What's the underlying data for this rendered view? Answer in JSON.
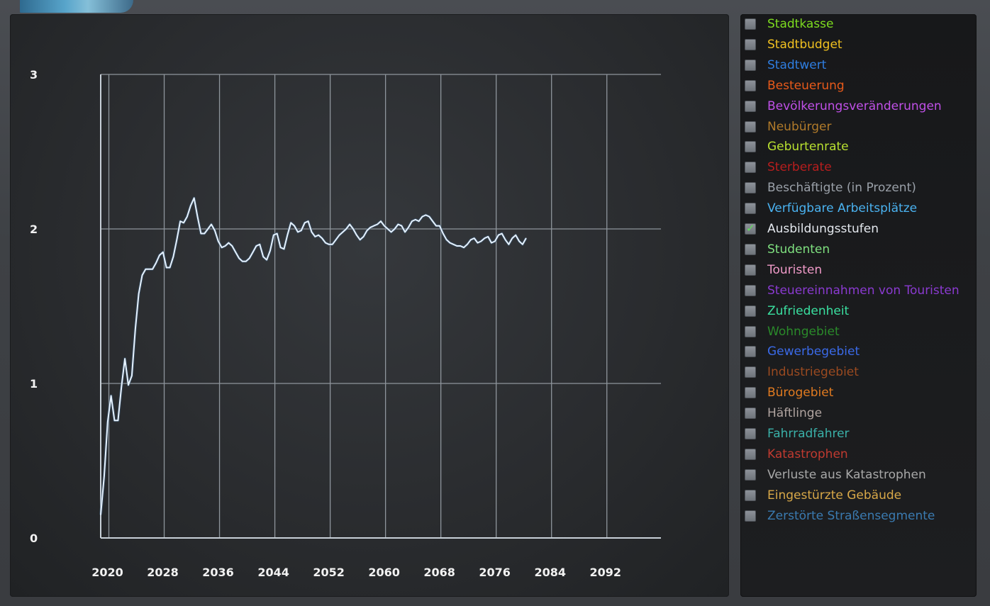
{
  "chart_data": {
    "type": "line",
    "y_ticks": [
      "0",
      "1",
      "2",
      "3"
    ],
    "ylim": [
      0,
      3
    ],
    "x_ticks": [
      "2020",
      "2028",
      "2036",
      "2044",
      "2052",
      "2060",
      "2068",
      "2076",
      "2084",
      "2092"
    ],
    "xlim": [
      2018,
      2099
    ],
    "grid": true,
    "series": [
      {
        "color": "#e6f2ff",
        "points": [
          [
            2018.0,
            0.15
          ],
          [
            2018.5,
            0.4
          ],
          [
            2019.0,
            0.75
          ],
          [
            2019.5,
            0.92
          ],
          [
            2020.0,
            0.76
          ],
          [
            2020.5,
            0.76
          ],
          [
            2021.0,
            0.98
          ],
          [
            2021.5,
            1.16
          ],
          [
            2022.0,
            0.99
          ],
          [
            2022.5,
            1.05
          ],
          [
            2023.0,
            1.35
          ],
          [
            2023.5,
            1.58
          ],
          [
            2024.0,
            1.7
          ],
          [
            2024.5,
            1.74
          ],
          [
            2025.0,
            1.74
          ],
          [
            2025.5,
            1.74
          ],
          [
            2026.0,
            1.78
          ],
          [
            2026.5,
            1.83
          ],
          [
            2027.0,
            1.85
          ],
          [
            2027.5,
            1.75
          ],
          [
            2028.0,
            1.75
          ],
          [
            2028.5,
            1.82
          ],
          [
            2029.0,
            1.93
          ],
          [
            2029.5,
            2.05
          ],
          [
            2030.0,
            2.04
          ],
          [
            2030.5,
            2.08
          ],
          [
            2031.0,
            2.15
          ],
          [
            2031.5,
            2.2
          ],
          [
            2032.0,
            2.08
          ],
          [
            2032.5,
            1.97
          ],
          [
            2033.0,
            1.97
          ],
          [
            2033.5,
            2.0
          ],
          [
            2034.0,
            2.03
          ],
          [
            2034.5,
            1.99
          ],
          [
            2035.0,
            1.92
          ],
          [
            2035.5,
            1.88
          ],
          [
            2036.0,
            1.89
          ],
          [
            2036.5,
            1.91
          ],
          [
            2037.0,
            1.89
          ],
          [
            2037.5,
            1.85
          ],
          [
            2038.0,
            1.81
          ],
          [
            2038.5,
            1.79
          ],
          [
            2039.0,
            1.79
          ],
          [
            2039.5,
            1.81
          ],
          [
            2040.0,
            1.85
          ],
          [
            2040.5,
            1.89
          ],
          [
            2041.0,
            1.9
          ],
          [
            2041.5,
            1.82
          ],
          [
            2042.0,
            1.8
          ],
          [
            2042.5,
            1.86
          ],
          [
            2043.0,
            1.96
          ],
          [
            2043.5,
            1.97
          ],
          [
            2044.0,
            1.88
          ],
          [
            2044.5,
            1.87
          ],
          [
            2045.0,
            1.96
          ],
          [
            2045.5,
            2.04
          ],
          [
            2046.0,
            2.02
          ],
          [
            2046.5,
            1.98
          ],
          [
            2047.0,
            1.99
          ],
          [
            2047.5,
            2.04
          ],
          [
            2048.0,
            2.05
          ],
          [
            2048.5,
            1.98
          ],
          [
            2049.0,
            1.95
          ],
          [
            2049.5,
            1.96
          ],
          [
            2050.0,
            1.94
          ],
          [
            2050.5,
            1.91
          ],
          [
            2051.0,
            1.9
          ],
          [
            2051.5,
            1.9
          ],
          [
            2052.0,
            1.93
          ],
          [
            2052.5,
            1.96
          ],
          [
            2053.0,
            1.98
          ],
          [
            2053.5,
            2.0
          ],
          [
            2054.0,
            2.03
          ],
          [
            2054.5,
            2.0
          ],
          [
            2055.0,
            1.96
          ],
          [
            2055.5,
            1.93
          ],
          [
            2056.0,
            1.95
          ],
          [
            2056.5,
            1.99
          ],
          [
            2057.0,
            2.01
          ],
          [
            2057.5,
            2.02
          ],
          [
            2058.0,
            2.03
          ],
          [
            2058.5,
            2.05
          ],
          [
            2059.0,
            2.02
          ],
          [
            2059.5,
            2.0
          ],
          [
            2060.0,
            1.98
          ],
          [
            2060.5,
            2.0
          ],
          [
            2061.0,
            2.03
          ],
          [
            2061.5,
            2.02
          ],
          [
            2062.0,
            1.98
          ],
          [
            2062.5,
            2.01
          ],
          [
            2063.0,
            2.05
          ],
          [
            2063.5,
            2.06
          ],
          [
            2064.0,
            2.05
          ],
          [
            2064.5,
            2.08
          ],
          [
            2065.0,
            2.09
          ],
          [
            2065.5,
            2.08
          ],
          [
            2066.0,
            2.05
          ],
          [
            2066.5,
            2.02
          ],
          [
            2067.0,
            2.02
          ],
          [
            2067.5,
            1.97
          ],
          [
            2068.0,
            1.93
          ],
          [
            2068.5,
            1.91
          ],
          [
            2069.0,
            1.9
          ],
          [
            2069.5,
            1.89
          ],
          [
            2070.0,
            1.89
          ],
          [
            2070.5,
            1.88
          ],
          [
            2071.0,
            1.9
          ],
          [
            2071.5,
            1.93
          ],
          [
            2072.0,
            1.94
          ],
          [
            2072.5,
            1.91
          ],
          [
            2073.0,
            1.92
          ],
          [
            2073.5,
            1.94
          ],
          [
            2074.0,
            1.95
          ],
          [
            2074.5,
            1.91
          ],
          [
            2075.0,
            1.92
          ],
          [
            2075.5,
            1.96
          ],
          [
            2076.0,
            1.97
          ],
          [
            2076.5,
            1.93
          ],
          [
            2077.0,
            1.9
          ],
          [
            2077.5,
            1.94
          ],
          [
            2078.0,
            1.96
          ],
          [
            2078.5,
            1.92
          ],
          [
            2079.0,
            1.9
          ],
          [
            2079.5,
            1.94
          ]
        ]
      }
    ]
  },
  "legend": {
    "items": [
      {
        "label": "Stadtkasse",
        "color": "#7ddc1f",
        "checked": false
      },
      {
        "label": "Stadtbudget",
        "color": "#f0c020",
        "checked": false
      },
      {
        "label": "Stadtwert",
        "color": "#2f7de0",
        "checked": false
      },
      {
        "label": "Besteuerung",
        "color": "#e85a1a",
        "checked": false
      },
      {
        "label": "Bevölkerungsveränderungen",
        "color": "#c050e8",
        "checked": false
      },
      {
        "label": "Neubürger",
        "color": "#b07a2a",
        "checked": false
      },
      {
        "label": "Geburtenrate",
        "color": "#b8e030",
        "checked": false
      },
      {
        "label": "Sterberate",
        "color": "#b81e1e",
        "checked": false
      },
      {
        "label": "Beschäftigte (in Prozent)",
        "color": "#9aa0a8",
        "checked": false
      },
      {
        "label": "Verfügbare Arbeitsplätze",
        "color": "#4ab2f0",
        "checked": false
      },
      {
        "label": "Ausbildungsstufen",
        "color": "#e4e8ee",
        "checked": true
      },
      {
        "label": "Studenten",
        "color": "#7fe07f",
        "checked": false
      },
      {
        "label": "Touristen",
        "color": "#f09ac8",
        "checked": false
      },
      {
        "label": "Steuereinnahmen von Touristen",
        "color": "#8a3ad0",
        "checked": false
      },
      {
        "label": "Zufriedenheit",
        "color": "#3ae0a0",
        "checked": false
      },
      {
        "label": "Wohngebiet",
        "color": "#2a8a2a",
        "checked": false
      },
      {
        "label": "Gewerbegebiet",
        "color": "#3a6ae8",
        "checked": false
      },
      {
        "label": "Industriegebiet",
        "color": "#9a4a20",
        "checked": false
      },
      {
        "label": "Bürogebiet",
        "color": "#e07a20",
        "checked": false
      },
      {
        "label": "Häftlinge",
        "color": "#b0a4a0",
        "checked": false
      },
      {
        "label": "Fahrradfahrer",
        "color": "#3ab0a8",
        "checked": false
      },
      {
        "label": "Katastrophen",
        "color": "#c03a30",
        "checked": false
      },
      {
        "label": "Verluste aus Katastrophen",
        "color": "#a8a8a8",
        "checked": false
      },
      {
        "label": "Eingestürzte Gebäude",
        "color": "#d8a848",
        "checked": false
      },
      {
        "label": "Zerstörte Straßensegmente",
        "color": "#3a7ab0",
        "checked": false
      }
    ]
  }
}
